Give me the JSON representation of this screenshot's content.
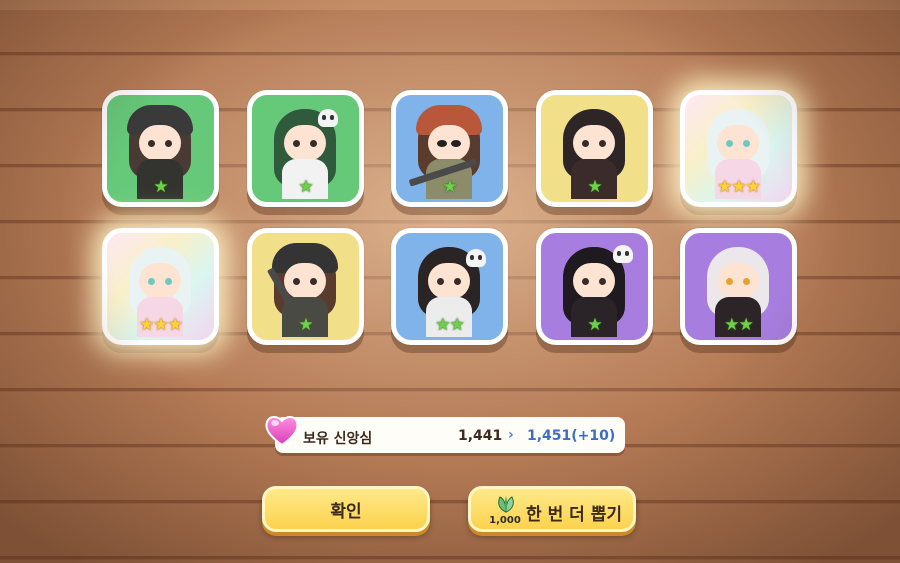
{
  "cards": [
    {
      "frame": "green",
      "stars": 1,
      "star_text": "★"
    },
    {
      "frame": "green",
      "stars": 1,
      "star_text": "★"
    },
    {
      "frame": "blue",
      "stars": 1,
      "star_text": "★"
    },
    {
      "frame": "yellow",
      "stars": 1,
      "star_text": "★"
    },
    {
      "frame": "rainbow",
      "stars": 3,
      "star_text": "★★★"
    },
    {
      "frame": "rainbow",
      "stars": 3,
      "star_text": "★★★"
    },
    {
      "frame": "yellow",
      "stars": 1,
      "star_text": "★"
    },
    {
      "frame": "blue",
      "stars": 2,
      "star_text": "★★"
    },
    {
      "frame": "purple",
      "stars": 1,
      "star_text": "★"
    },
    {
      "frame": "purple",
      "stars": 2,
      "star_text": "★★"
    }
  ],
  "faith": {
    "icon": "heart-icon",
    "label": "보유 신앙심",
    "current": "1,441",
    "arrow": "›",
    "new": "1,451(+10)"
  },
  "buttons": {
    "confirm": "확인",
    "draw_again": "한 번 더 뽑기",
    "draw_cost": "1,000",
    "cost_icon": "leaf-icon"
  },
  "colors": {
    "green": "#66c97a",
    "blue": "#7fb3ea",
    "yellow": "#f2df8a",
    "purple": "#a77ee0",
    "button": "#fcd24c",
    "accent_blue": "#3a6fc9"
  }
}
